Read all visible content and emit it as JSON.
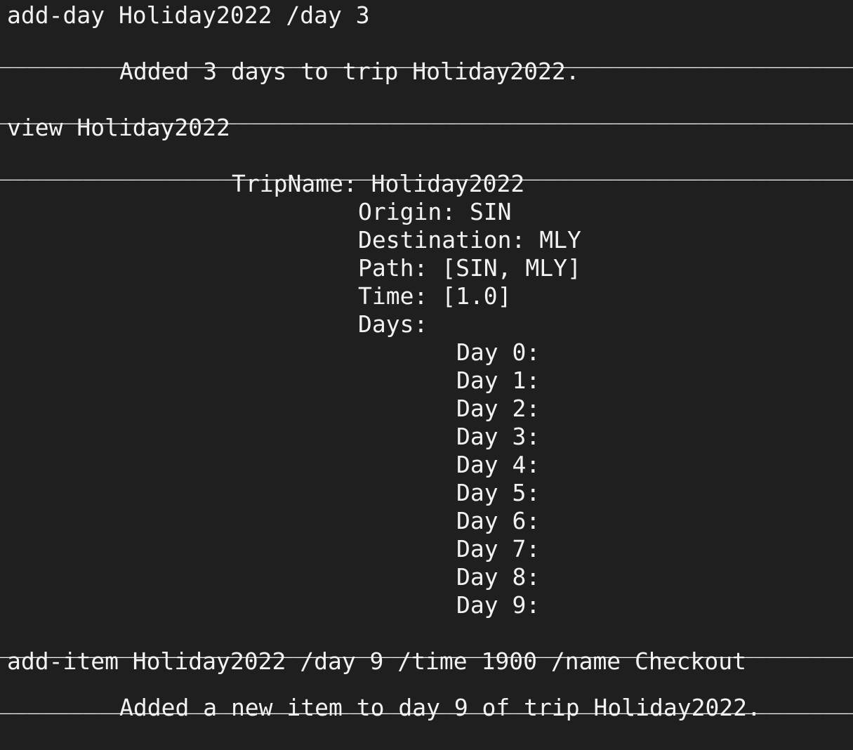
{
  "terminal": {
    "separator": "______________________________________________________________",
    "cmd1": "add-day Holiday2022 /day 3",
    "resp1": "Added 3 days to trip Holiday2022.",
    "cmd2": "view Holiday2022",
    "trip": {
      "name_line": "TripName: Holiday2022",
      "origin_line": "Origin: SIN",
      "destination_line": "Destination: MLY",
      "path_line": "Path: [SIN, MLY]",
      "time_line": "Time: [1.0]",
      "days_label": "Days:",
      "days": [
        "Day 0:",
        "Day 1:",
        "Day 2:",
        "Day 3:",
        "Day 4:",
        "Day 5:",
        "Day 6:",
        "Day 7:",
        "Day 8:",
        "Day 9:"
      ]
    },
    "cmd3": "add-item Holiday2022 /day 9 /time 1900 /name Checkout",
    "resp3": "Added a new item to day 9 of trip Holiday2022."
  }
}
